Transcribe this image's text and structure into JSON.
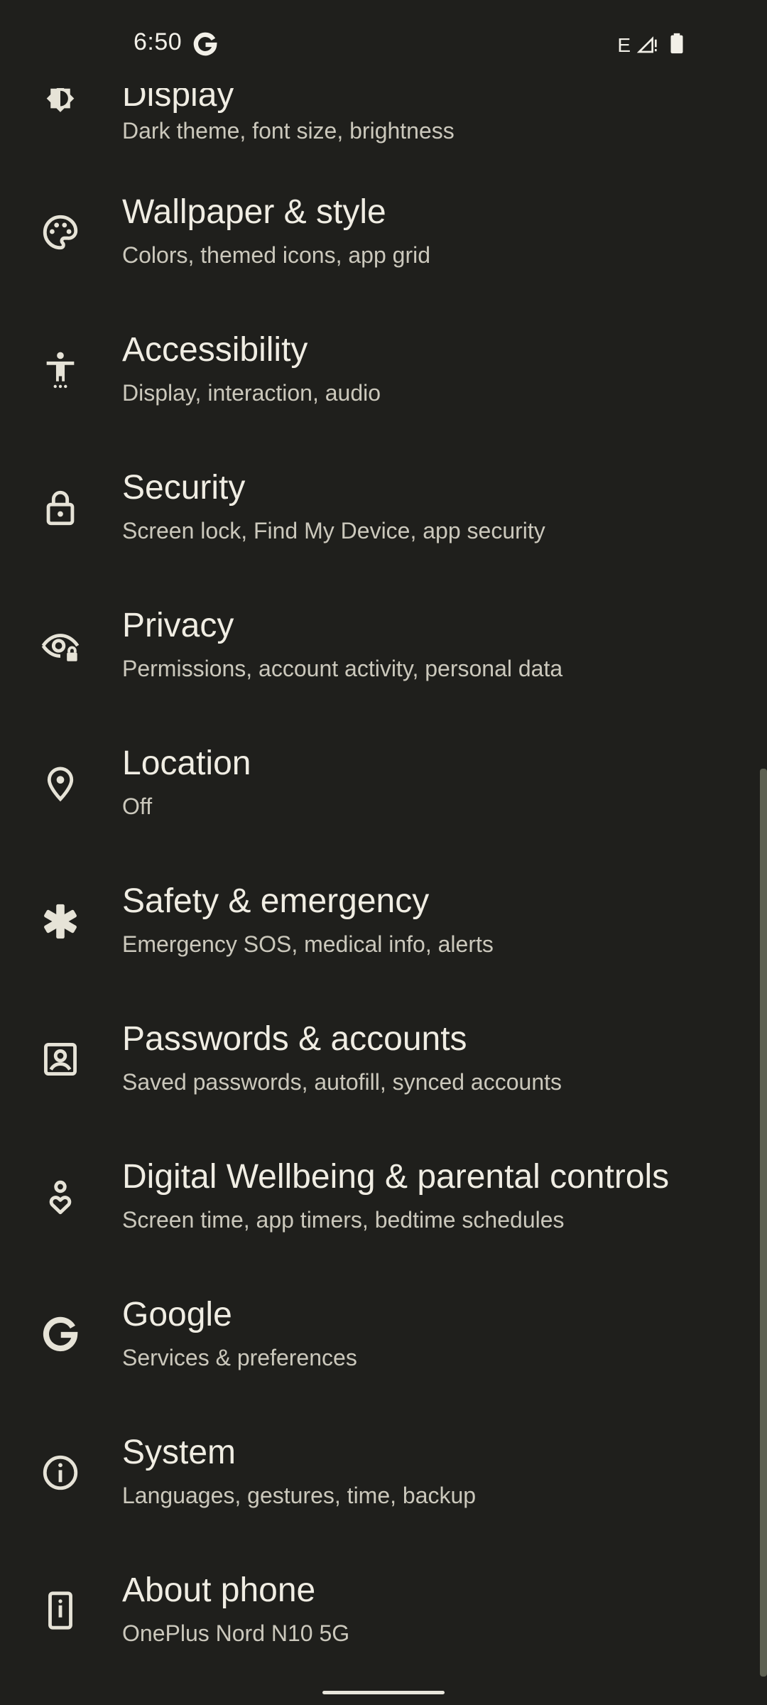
{
  "status_bar": {
    "time": "6:50",
    "network": "E"
  },
  "settings": {
    "items": [
      {
        "title": "Display",
        "summary": "Dark theme, font size, brightness",
        "icon": "display-icon"
      },
      {
        "title": "Wallpaper & style",
        "summary": "Colors, themed icons, app grid",
        "icon": "palette-icon"
      },
      {
        "title": "Accessibility",
        "summary": "Display, interaction, audio",
        "icon": "accessibility-icon"
      },
      {
        "title": "Security",
        "summary": "Screen lock, Find My Device, app security",
        "icon": "lock-icon"
      },
      {
        "title": "Privacy",
        "summary": "Permissions, account activity, personal data",
        "icon": "eye-lock-icon"
      },
      {
        "title": "Location",
        "summary": "Off",
        "icon": "location-pin-icon"
      },
      {
        "title": "Safety & emergency",
        "summary": "Emergency SOS, medical info, alerts",
        "icon": "asterisk-icon"
      },
      {
        "title": "Passwords & accounts",
        "summary": "Saved passwords, autofill, synced accounts",
        "icon": "account-box-icon"
      },
      {
        "title": "Digital Wellbeing & parental controls",
        "summary": "Screen time, app timers, bedtime schedules",
        "icon": "wellbeing-icon"
      },
      {
        "title": "Google",
        "summary": "Services & preferences",
        "icon": "google-icon"
      },
      {
        "title": "System",
        "summary": "Languages, gestures, time, backup",
        "icon": "info-icon"
      },
      {
        "title": "About phone",
        "summary": "OnePlus Nord N10 5G",
        "icon": "phone-icon"
      }
    ]
  },
  "colors": {
    "background": "#1f1f1c",
    "title": "#f0ede3",
    "summary": "#cbc8bc",
    "icon": "#e6e3d7",
    "scrollbar": "#5e6152"
  }
}
